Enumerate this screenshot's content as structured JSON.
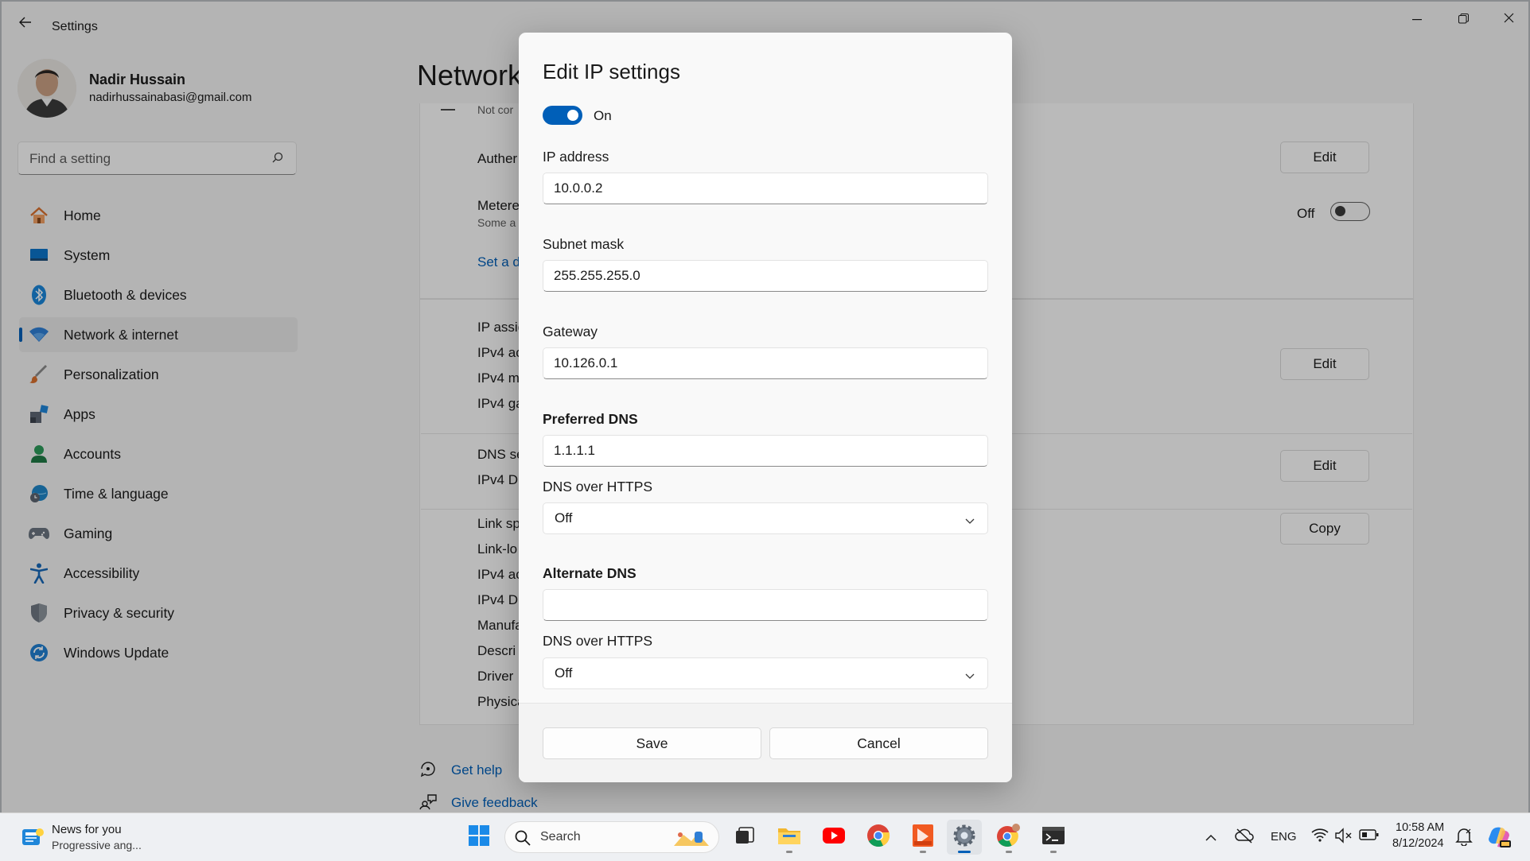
{
  "window": {
    "title": "Settings",
    "user": {
      "name": "Nadir Hussain",
      "email": "nadirhussainabasi@gmail.com"
    },
    "search": {
      "placeholder": "Find a setting"
    },
    "sidebar": {
      "items": [
        {
          "label": "Home",
          "icon": "home-icon",
          "color": "#e07b39"
        },
        {
          "label": "System",
          "icon": "system-icon",
          "color": "#0a72c4"
        },
        {
          "label": "Bluetooth & devices",
          "icon": "bluetooth-icon",
          "color": "#1a86d9"
        },
        {
          "label": "Network & internet",
          "icon": "network-icon",
          "color": "#2f7fd6",
          "active": true
        },
        {
          "label": "Personalization",
          "icon": "brush-icon",
          "color": "#d46a2a"
        },
        {
          "label": "Apps",
          "icon": "apps-icon",
          "color": "#4a5563"
        },
        {
          "label": "Accounts",
          "icon": "accounts-icon",
          "color": "#2c9a5a"
        },
        {
          "label": "Time & language",
          "icon": "globe-clock-icon",
          "color": "#1f86c8"
        },
        {
          "label": "Gaming",
          "icon": "gamepad-icon",
          "color": "#6b7480"
        },
        {
          "label": "Accessibility",
          "icon": "accessibility-icon",
          "color": "#1768b8"
        },
        {
          "label": "Privacy & security",
          "icon": "shield-icon",
          "color": "#6f7782"
        },
        {
          "label": "Windows Update",
          "icon": "update-icon",
          "color": "#1f7fd1"
        }
      ]
    },
    "page_title": "Network",
    "background_rows": {
      "not_connected": "Not cor",
      "authentication": "Auther",
      "metered": "Metere",
      "metered_sub": "Some a",
      "metered_state": "Off",
      "set_data_limit": "Set a d",
      "ip_assignment": "IP assig",
      "ipv4_address": "IPv4 ac",
      "ipv4_mask": "IPv4 m",
      "ipv4_gateway": "IPv4 ga",
      "dns_server": "DNS se",
      "ipv4_dns": "IPv4 DI",
      "link_speed": "Link sp",
      "link_local": "Link-lo",
      "ipv4_address2": "IPv4 ac",
      "ipv4_dns2": "IPv4 DI",
      "manufacturer": "Manufa",
      "description": "Descri",
      "driver": "Driver",
      "physical": "Physica",
      "edit1": "Edit",
      "edit2": "Edit",
      "edit3": "Edit",
      "copy": "Copy"
    },
    "footer_links": {
      "get_help": "Get help",
      "give_feedback": "Give feedback"
    }
  },
  "dialog": {
    "title": "Edit IP settings",
    "ipv4_toggle": {
      "state": "On"
    },
    "ip_address": {
      "label": "IP address",
      "value": "10.0.0.2"
    },
    "subnet_mask": {
      "label": "Subnet mask",
      "value": "255.255.255.0"
    },
    "gateway": {
      "label": "Gateway",
      "value": "10.126.0.1"
    },
    "preferred_dns": {
      "label": "Preferred DNS",
      "value": "1.1.1.1"
    },
    "preferred_doh": {
      "label": "DNS over HTTPS",
      "value": "Off"
    },
    "alternate_dns": {
      "label": "Alternate DNS",
      "value": ""
    },
    "alternate_doh": {
      "label": "DNS over HTTPS",
      "value": "Off"
    },
    "save_label": "Save",
    "cancel_label": "Cancel",
    "accent": "#005fb8"
  },
  "taskbar": {
    "news": {
      "title": "News for you",
      "subtitle": "Progressive ang..."
    },
    "search_label": "Search",
    "apps": [
      "start-icon",
      "search-icon",
      "task-view-icon",
      "file-explorer-icon",
      "youtube-icon",
      "chrome-icon",
      "reader-icon",
      "settings-icon",
      "chrome-profile-icon",
      "terminal-icon"
    ],
    "tray": {
      "language": "ENG",
      "time": "10:58 AM",
      "date": "8/12/2024"
    }
  }
}
